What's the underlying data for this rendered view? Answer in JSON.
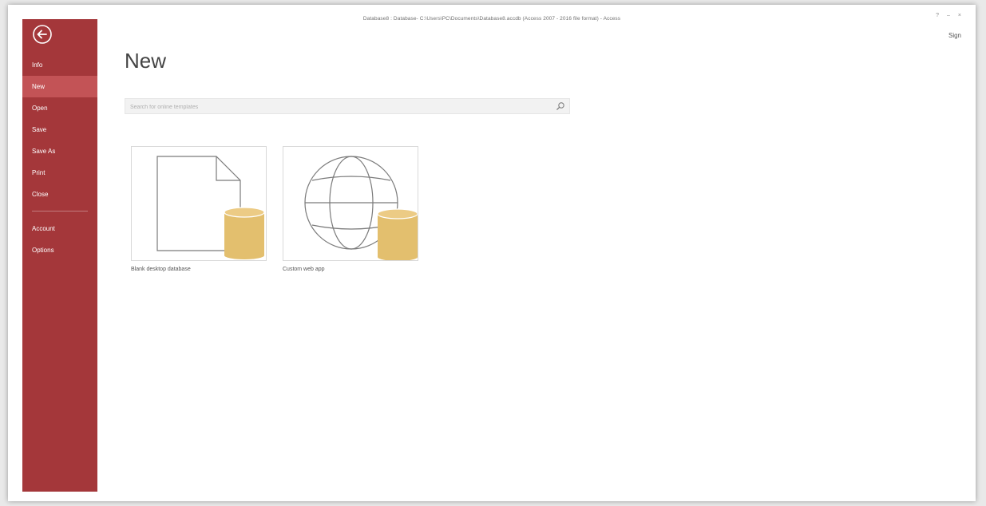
{
  "window": {
    "title": "Database8 : Database- C:\\Users\\PC\\Documents\\Database8.accdb (Access 2007 - 2016 file format) - Access",
    "controls": [
      "?",
      "–",
      "×"
    ],
    "sign_in": "Sign"
  },
  "sidebar": {
    "back_icon": "back-arrow-icon",
    "items": [
      {
        "label": "Info"
      },
      {
        "label": "New"
      },
      {
        "label": "Open"
      },
      {
        "label": "Save"
      },
      {
        "label": "Save As"
      },
      {
        "label": "Print"
      },
      {
        "label": "Close"
      },
      {
        "label": "Account"
      },
      {
        "label": "Options"
      }
    ],
    "active_item": "New"
  },
  "main": {
    "title": "New",
    "search": {
      "placeholder": "Search for online templates",
      "value": "",
      "icon": "search-icon"
    },
    "templates": [
      {
        "label": "Blank desktop database",
        "icon": "blank-document-database-icon"
      },
      {
        "label": "Custom web app",
        "icon": "globe-database-icon"
      }
    ]
  },
  "colors": {
    "sidebar_bg": "#a4373a",
    "sidebar_active": "#c35356",
    "database_cylinder": "#e3bf6e"
  }
}
